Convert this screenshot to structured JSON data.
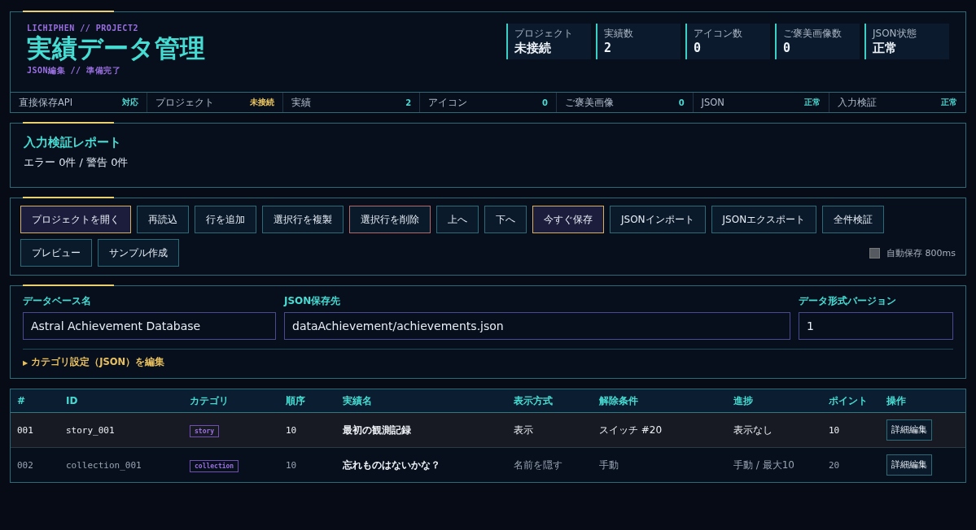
{
  "header": {
    "breadcrumb": "LICHIPHEN // PROJECT2",
    "title": "実績データ管理",
    "subtitle": "JSON編集 // 準備完了",
    "stats": [
      {
        "label": "プロジェクト",
        "value": "未接続"
      },
      {
        "label": "実績数",
        "value": "2"
      },
      {
        "label": "アイコン数",
        "value": "0"
      },
      {
        "label": "ご褒美画像数",
        "value": "0"
      },
      {
        "label": "JSON状態",
        "value": "正常"
      }
    ]
  },
  "status_bar": [
    {
      "label": "直接保存API",
      "value": "対応",
      "color": "#4fd8d0"
    },
    {
      "label": "プロジェクト",
      "value": "未接続",
      "color": "#f0c860"
    },
    {
      "label": "実績",
      "value": "2",
      "color": "#4fd8d0"
    },
    {
      "label": "アイコン",
      "value": "0",
      "color": "#4fd8d0"
    },
    {
      "label": "ご褒美画像",
      "value": "0",
      "color": "#4fd8d0"
    },
    {
      "label": "JSON",
      "value": "正常",
      "color": "#4fd8d0"
    },
    {
      "label": "入力検証",
      "value": "正常",
      "color": "#4fd8d0"
    }
  ],
  "validation": {
    "title": "入力検証レポート",
    "summary": "エラー 0件 / 警告 0件"
  },
  "toolbar": {
    "buttons": [
      {
        "label": "プロジェクトを開く",
        "kind": "primary"
      },
      {
        "label": "再読込",
        "kind": "normal"
      },
      {
        "label": "行を追加",
        "kind": "normal"
      },
      {
        "label": "選択行を複製",
        "kind": "normal"
      },
      {
        "label": "選択行を削除",
        "kind": "danger"
      },
      {
        "label": "上へ",
        "kind": "normal"
      },
      {
        "label": "下へ",
        "kind": "normal"
      },
      {
        "label": "今すぐ保存",
        "kind": "primary"
      },
      {
        "label": "JSONインポート",
        "kind": "normal"
      },
      {
        "label": "JSONエクスポート",
        "kind": "normal"
      },
      {
        "label": "全件検証",
        "kind": "normal"
      },
      {
        "label": "プレビュー",
        "kind": "normal"
      },
      {
        "label": "サンプル作成",
        "kind": "normal"
      }
    ],
    "autosave": {
      "label": "自動保存 800ms",
      "checked": false
    }
  },
  "settings": {
    "fields": [
      {
        "label": "データベース名",
        "value": "Astral Achievement Database"
      },
      {
        "label": "JSON保存先",
        "value": "dataAchievement/achievements.json"
      },
      {
        "label": "データ形式バージョン",
        "value": "1"
      }
    ],
    "category_toggle": {
      "icon": "▶",
      "label": "カテゴリ設定（JSON）を編集",
      "expanded": false
    }
  },
  "table": {
    "columns": [
      "#",
      "ID",
      "カテゴリ",
      "順序",
      "実績名",
      "表示方式",
      "解除条件",
      "進捗",
      "ポイント",
      "操作"
    ],
    "rows": [
      {
        "selected": true,
        "cells": [
          "001",
          "story_001",
          "story",
          "10",
          "最初の観測記録",
          "表示",
          "スイッチ #20",
          "表示なし",
          "10"
        ],
        "action": "詳細編集"
      },
      {
        "selected": false,
        "cells": [
          "002",
          "collection_001",
          "collection",
          "10",
          "忘れものはないかな？",
          "名前を隠す",
          "手動",
          "手動 / 最大10",
          "20"
        ],
        "action": "詳細編集"
      }
    ]
  }
}
